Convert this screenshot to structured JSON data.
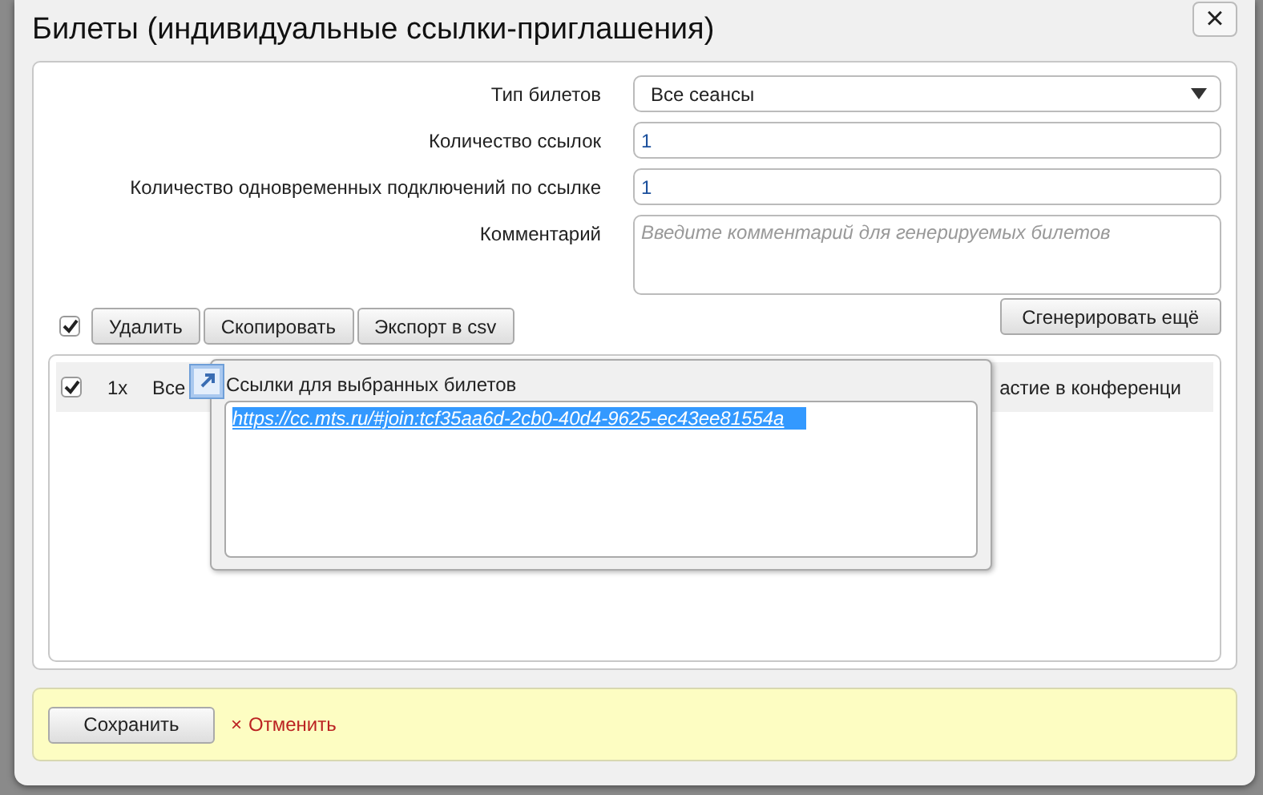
{
  "dialog": {
    "title": "Билеты (индивидуальные ссылки-приглашения)",
    "close": "×"
  },
  "form": {
    "fields": [
      {
        "kind": "select",
        "label": "Тип билетов",
        "value": "Все сеансы"
      },
      {
        "kind": "input",
        "label": "Количество ссылок",
        "value": "1"
      },
      {
        "kind": "input",
        "label": "Количество одновременных подключений по ссылке",
        "value": "1"
      },
      {
        "kind": "textarea",
        "label": "Комментарий",
        "placeholder": "Введите комментарий для генерируемых билетов"
      }
    ],
    "generate_button": "Сгенерировать ещё"
  },
  "toolbar": {
    "select_all": {
      "checked": true
    },
    "buttons": [
      "Удалить",
      "Скопировать",
      "Экспорт в csv"
    ]
  },
  "table": {
    "rows": [
      {
        "checked": true,
        "column_2": "1x",
        "column_3": "Все",
        "column_4": "астие в конференци"
      }
    ]
  },
  "popup": {
    "title": "Ссылки для выбранных билетов",
    "links": [
      "https://cc.mts.ru/#join:tcf35aa6d-2cb0-40d4-9625-ec43ee81554a"
    ]
  },
  "footer": {
    "save": "Сохранить",
    "cancel_icon": "×",
    "cancel": "Отменить"
  }
}
